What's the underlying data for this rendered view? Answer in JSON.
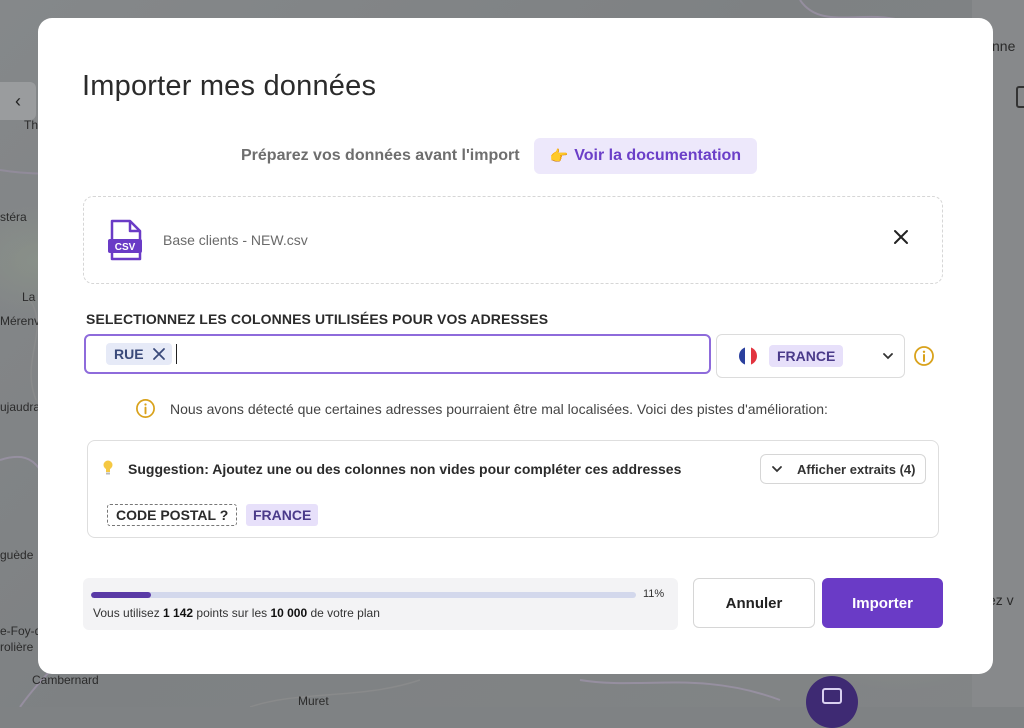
{
  "background": {
    "map_labels": [
      "Th",
      "stéra",
      "La",
      "Mérenv",
      "ujaudra",
      "guède",
      "e-Foy-d",
      "rolière",
      "Cambernard",
      "Muret"
    ],
    "side_panel_text_top": "nne",
    "side_panel_text_bottom": "ez v"
  },
  "modal": {
    "title": "Importer mes données",
    "prep_text": "Préparez vos données avant l'import",
    "doc_button": {
      "icon": "pointing-hand-icon",
      "emoji": "👉",
      "label": "Voir la documentation"
    },
    "file": {
      "icon": "csv-file-icon",
      "icon_label": "CSV",
      "name": "Base clients - NEW.csv"
    },
    "columns_section": {
      "title": "SELECTIONNEZ LES COLONNES UTILISÉES POUR VOS ADRESSES",
      "selected_columns": [
        "RUE"
      ],
      "country": "FRANCE"
    },
    "warning": {
      "text": "Nous avons détecté que certaines adresses pourraient être mal localisées. Voici des pistes d'amélioration:"
    },
    "suggestion": {
      "text": "Suggestion: Ajoutez une ou des colonnes non vides pour compléter ces addresses",
      "extract_button": "Afficher extraits (4)",
      "missing_chip": "CODE POSTAL ?",
      "country_chip": "FRANCE"
    },
    "usage": {
      "percent_label": "11%",
      "fraction": 0.11,
      "text_prefix": "Vous utilisez ",
      "used": "1 142",
      "text_middle": " points sur les ",
      "total": "10 000",
      "text_suffix": " de votre plan"
    },
    "buttons": {
      "cancel": "Annuler",
      "import": "Importer"
    }
  },
  "colors": {
    "accent": "#6a3bc6",
    "accent_soft": "#ede8fb",
    "warning": "#d9a21b",
    "progress_track": "#d3d8ec"
  }
}
